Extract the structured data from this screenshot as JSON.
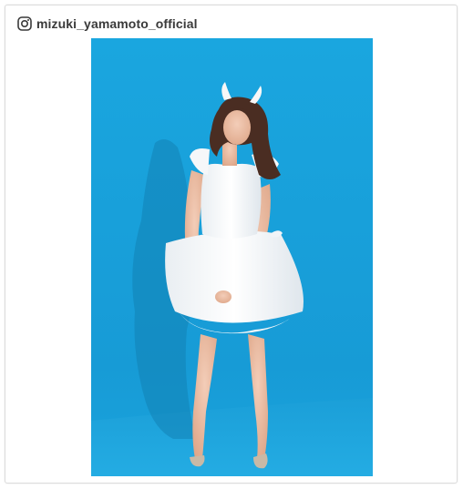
{
  "post": {
    "username": "mizuki_yamamoto_official",
    "platform_icon": "instagram-icon",
    "photo": {
      "subject": "woman-in-white-devil-costume",
      "background_color": "#1a9fd8"
    }
  },
  "colors": {
    "username_text": "#3a3a3a",
    "card_border": "#dcdcdc",
    "backdrop_blue": "#1a9fd8"
  }
}
